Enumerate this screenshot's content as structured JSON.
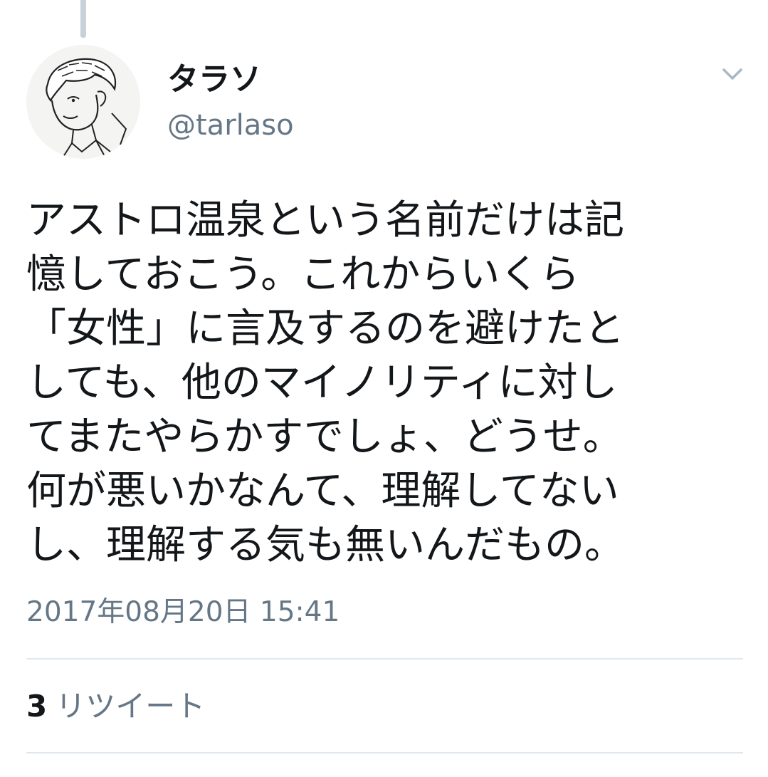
{
  "tweet": {
    "author": {
      "display_name": "タラソ",
      "handle": "@tarlaso",
      "avatar_icon": "sketch-portrait-avatar"
    },
    "text": "アストロ温泉という名前だけは記\n憶しておこう。これからいくら\n「女性」に言及するのを避けたと\nしても、他のマイノリティに対し\nてまたやらかすでしょ、どうせ。\n何が悪いかなんて、理解してない\nし、理解する気も無いんだもの。",
    "timestamp": "2017年08月20日 15:41",
    "stats": {
      "retweet_count": "3",
      "retweet_label": "リツイート"
    },
    "menu_icon": "chevron-down-icon"
  },
  "colors": {
    "primary_text": "#14171a",
    "secondary_text": "#657786",
    "divider": "#e1e8ed",
    "thread_line": "#c9d1d8"
  }
}
